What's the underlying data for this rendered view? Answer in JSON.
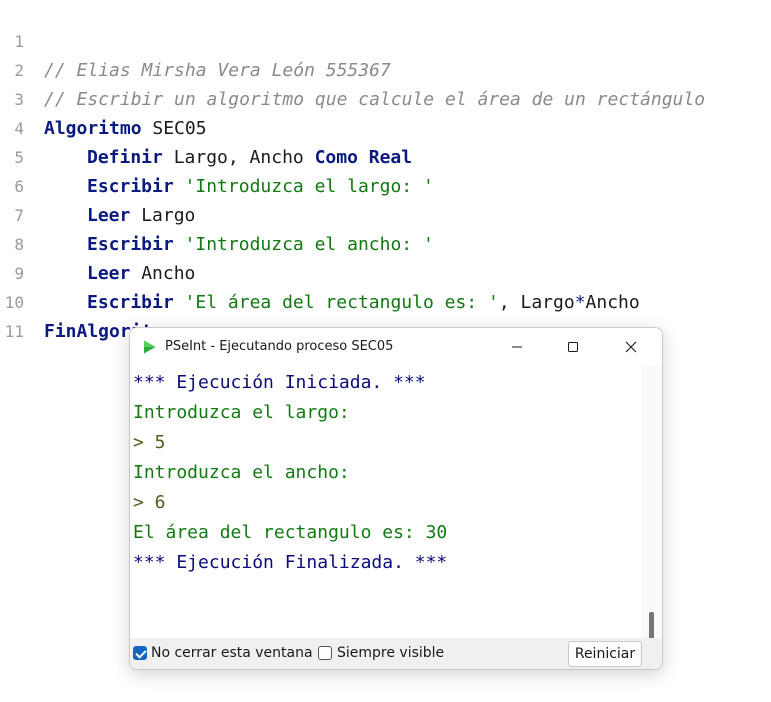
{
  "editor": {
    "lines": [
      {
        "n": "1",
        "comment": "// Elias Mirsha Vera León 555367"
      },
      {
        "n": "2",
        "comment": "// Escribir un algoritmo que calcule el área de un rectángulo"
      },
      {
        "n": "3",
        "kw": "Algoritmo",
        "rest": " SEC05"
      },
      {
        "n": "4",
        "kw": "Definir",
        "mid": " Largo, Ancho ",
        "kw2": "Como Real"
      },
      {
        "n": "5",
        "kw": "Escribir",
        "str": "'Introduzca el largo: '"
      },
      {
        "n": "6",
        "kw": "Leer",
        "rest": " Largo"
      },
      {
        "n": "7",
        "kw": "Escribir",
        "str": "'Introduzca el ancho: '"
      },
      {
        "n": "8",
        "kw": "Leer",
        "rest": " Ancho"
      },
      {
        "n": "9",
        "kw": "Escribir",
        "str": "'El área del rectangulo es: '",
        "tail1": ", Largo",
        "op": "*",
        "tail2": "Ancho"
      },
      {
        "n": "10",
        "kw": "FinAlgoritmo"
      },
      {
        "n": "11"
      }
    ]
  },
  "window": {
    "title": "PSeInt - Ejecutando proceso SEC05",
    "minimize_glyph": "—",
    "maximize_glyph": "☐",
    "close_glyph": "✕"
  },
  "console": {
    "lines": [
      {
        "text": "*** Ejecución Iniciada. ***",
        "kind": "info"
      },
      {
        "text": "Introduzca el largo:",
        "kind": "out"
      },
      {
        "text": "> 5",
        "kind": "in"
      },
      {
        "text": "Introduzca el ancho:",
        "kind": "out"
      },
      {
        "text": "> 6",
        "kind": "in"
      },
      {
        "text": "El área del rectangulo es: 30",
        "kind": "out"
      },
      {
        "text": "*** Ejecución Finalizada. ***",
        "kind": "info"
      }
    ]
  },
  "bottom": {
    "keep_open_label": "No cerrar esta ventana",
    "keep_open_checked": true,
    "always_visible_label": "Siempre visible",
    "always_visible_checked": false,
    "restart_label": "Reiniciar"
  },
  "colors": {
    "keyword": "#0a1a80",
    "string": "#117711",
    "comment": "#8a8a8a",
    "checkbox_accent": "#1565c0"
  },
  "icons": {
    "app": "pseint-play-icon",
    "minimize": "minimize-icon",
    "maximize": "maximize-icon",
    "close": "close-icon"
  }
}
